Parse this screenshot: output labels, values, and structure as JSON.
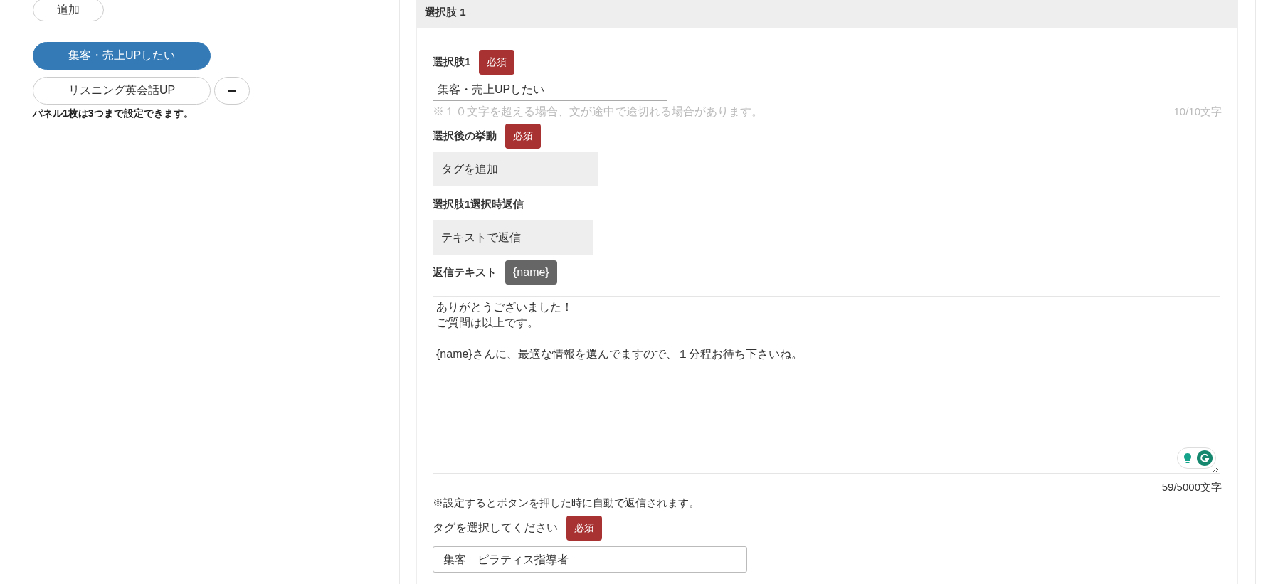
{
  "left_panel": {
    "add_button": "追加",
    "choices": [
      {
        "label": "集客・売上UPしたい",
        "selected": true
      },
      {
        "label": "リスニング英会話UP",
        "selected": false
      }
    ],
    "note": "パネル1枚は3つまで設定できます。"
  },
  "section": {
    "title": "選択肢 1",
    "fields": [
      {
        "kind": "text",
        "label": "選択肢1",
        "required_badge": "必須",
        "value": "集客・売上UPしたい",
        "hint": "※１０文字を超える場合、文が途中で途切れる場合があります。",
        "counter": "10/10文字"
      },
      {
        "kind": "display",
        "label": "選択後の挙動",
        "required_badge": "必須",
        "value": "タグを追加"
      },
      {
        "kind": "display",
        "label": "選択肢1選択時返信",
        "value": "テキストで返信"
      },
      {
        "kind": "textarea",
        "label": "返信テキスト",
        "variable_chip": "{name}",
        "paragraphs": [
          [
            "ありがとうございました！",
            "ご質問は以上です。"
          ],
          [
            "{name}さんに、最適な情報を選んでますので、１分程お待ち下さいね。"
          ]
        ],
        "counter": "59/5000文字",
        "note": "※設定するとボタンを押した時に自動で返信されます。"
      },
      {
        "kind": "tag",
        "label": "タグを選択してください",
        "required_badge": "必須",
        "value": "集客　ピラティス指導者"
      }
    ]
  }
}
